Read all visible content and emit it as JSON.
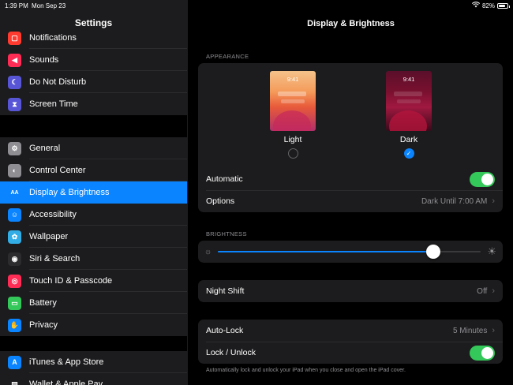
{
  "status": {
    "time": "1:39 PM",
    "date": "Mon Sep 23",
    "battery": "82%",
    "battery_level": 0.82
  },
  "sidebar": {
    "title": "Settings",
    "group1": [
      {
        "label": "Notifications",
        "icon": "notifications-icon",
        "color": "#ff3b30"
      },
      {
        "label": "Sounds",
        "icon": "sounds-icon",
        "color": "#ff2d55"
      },
      {
        "label": "Do Not Disturb",
        "icon": "moon-icon",
        "color": "#5856d6"
      },
      {
        "label": "Screen Time",
        "icon": "hourglass-icon",
        "color": "#5856d6"
      }
    ],
    "group2": [
      {
        "label": "General",
        "icon": "gear-icon",
        "color": "#8e8e93"
      },
      {
        "label": "Control Center",
        "icon": "toggles-icon",
        "color": "#8e8e93"
      },
      {
        "label": "Display & Brightness",
        "icon": "aa-icon",
        "color": "#0a84ff",
        "active": true
      },
      {
        "label": "Accessibility",
        "icon": "accessibility-icon",
        "color": "#0a84ff"
      },
      {
        "label": "Wallpaper",
        "icon": "flower-icon",
        "color": "#32ade6"
      },
      {
        "label": "Siri & Search",
        "icon": "siri-icon",
        "color": "#2c2c2e"
      },
      {
        "label": "Touch ID & Passcode",
        "icon": "fingerprint-icon",
        "color": "#ff2d55"
      },
      {
        "label": "Battery",
        "icon": "battery-icon",
        "color": "#34c759"
      },
      {
        "label": "Privacy",
        "icon": "hand-icon",
        "color": "#0a84ff"
      }
    ],
    "group3": [
      {
        "label": "iTunes & App Store",
        "icon": "app-store-icon",
        "color": "#0a84ff"
      },
      {
        "label": "Wallet & Apple Pay",
        "icon": "wallet-icon",
        "color": "#1c1c1e"
      }
    ]
  },
  "main": {
    "title": "Display & Brightness",
    "appearance": {
      "section": "APPEARANCE",
      "light": {
        "label": "Light",
        "time": "9:41",
        "selected": false
      },
      "dark": {
        "label": "Dark",
        "time": "9:41",
        "selected": true
      },
      "automatic_label": "Automatic",
      "automatic_on": true,
      "options_label": "Options",
      "options_value": "Dark Until 7:00 AM"
    },
    "brightness": {
      "section": "BRIGHTNESS",
      "level": 0.82
    },
    "night_shift": {
      "label": "Night Shift",
      "value": "Off"
    },
    "auto_lock": {
      "label": "Auto-Lock",
      "value": "5 Minutes"
    },
    "lock_unlock": {
      "label": "Lock / Unlock",
      "on": true
    },
    "footnote": "Automatically lock and unlock your iPad when you close and open the iPad cover."
  }
}
